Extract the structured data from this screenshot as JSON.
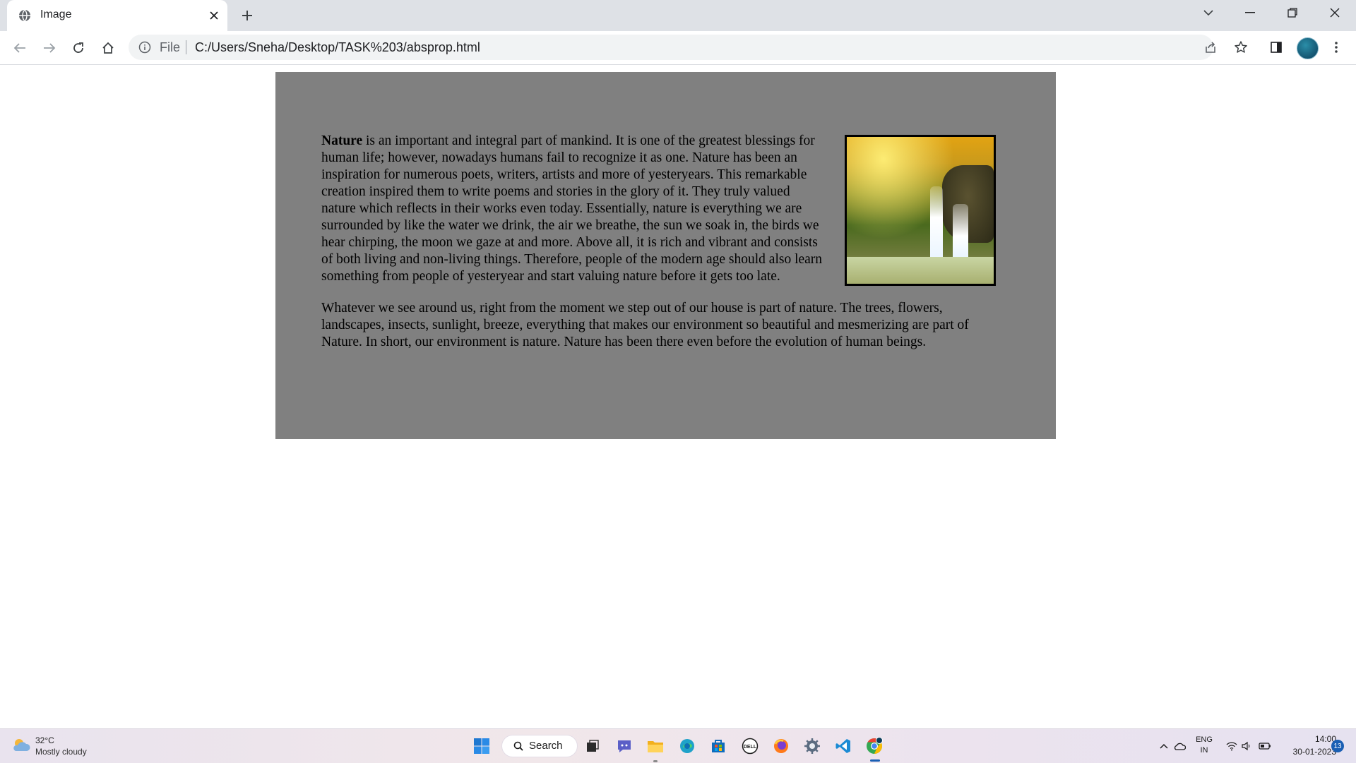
{
  "browser": {
    "tab": {
      "title": "Image"
    },
    "address_bar": {
      "scheme_label": "File",
      "url": "C:/Users/Sneha/Desktop/TASK%203/absprop.html"
    }
  },
  "page": {
    "paragraph1": {
      "bold_lead": "Nature",
      "text": " is an important and integral part of mankind. It is one of the greatest blessings for human life; however, nowadays humans fail to recognize it as one. Nature has been an inspiration for numerous poets, writers, artists and more of yesteryears. This remarkable creation inspired them to write poems and stories in the glory of it. They truly valued nature which reflects in their works even today. Essentially, nature is everything we are surrounded by like the water we drink, the air we breathe, the sun we soak in, the birds we hear chirping, the moon we gaze at and more. Above all, it is rich and vibrant and consists of both living and non-living things. Therefore, people of the modern age should also learn something from people of yesteryear and start valuing nature before it gets too late."
    },
    "paragraph2": "Whatever we see around us, right from the moment we step out of our house is part of nature. The trees, flowers, landscapes, insects, sunlight, breeze, everything that makes our environment so beautiful and mesmerizing are part of Nature. In short, our environment is nature. Nature has been there even before the evolution of human beings.",
    "background_color": "#808080"
  },
  "taskbar": {
    "weather": {
      "temp": "32°C",
      "condition": "Mostly cloudy"
    },
    "search_label": "Search",
    "tray": {
      "lang_top": "ENG",
      "lang_bottom": "IN",
      "time": "14:00",
      "date": "30-01-2023",
      "notification_count": "13"
    }
  }
}
